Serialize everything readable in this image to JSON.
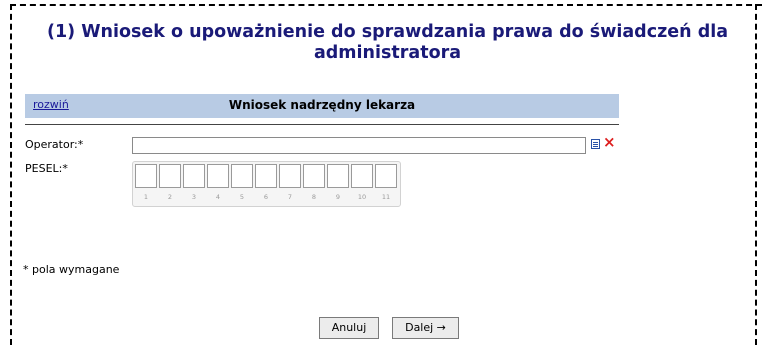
{
  "title": "(1) Wniosek o upoważnienie do sprawdzania prawa do świadczeń dla administratora",
  "section": {
    "toggle_label": "rozwiń",
    "title": "Wniosek nadrzędny lekarza"
  },
  "form": {
    "operator_label": "Operator:*",
    "operator_value": "",
    "pesel_label": "PESEL:*",
    "pesel_digit_numbers": [
      "1",
      "2",
      "3",
      "4",
      "5",
      "6",
      "7",
      "8",
      "9",
      "10",
      "11"
    ]
  },
  "required_note": "* pola wymagane",
  "buttons": {
    "cancel": "Anuluj",
    "next": "Dalej →"
  },
  "icons": {
    "list": "list-icon",
    "clear": "clear-x-icon"
  },
  "colors": {
    "title": "#1a1a78",
    "section_bar": "#b8cbe4",
    "clear_icon": "#dd1e1e"
  }
}
